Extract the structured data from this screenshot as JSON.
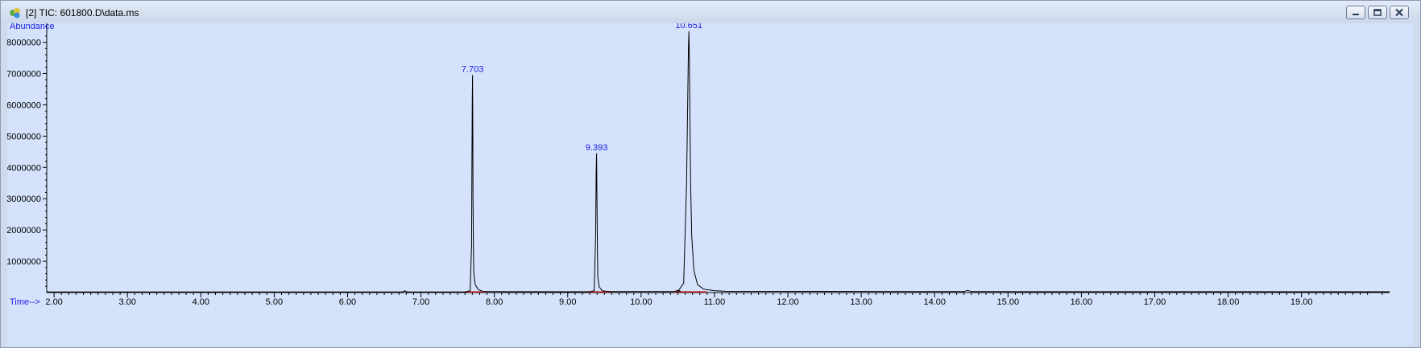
{
  "window": {
    "title": "[2] TIC: 601800.D\\data.ms"
  },
  "colors": {
    "plot_background": "#d4e3fb",
    "trace": "#000000",
    "peak_label": "#1a1ae6",
    "baseline_marker": "#e03030"
  },
  "chart_data": {
    "type": "line",
    "xlabel": "Time-->",
    "ylabel": "Abundance",
    "xlim": [
      1.9,
      20.2
    ],
    "ylim": [
      0,
      8400000
    ],
    "x_ticks": [
      "2.00",
      "3.00",
      "4.00",
      "5.00",
      "6.00",
      "7.00",
      "8.00",
      "9.00",
      "10.00",
      "11.00",
      "12.00",
      "13.00",
      "14.00",
      "15.00",
      "16.00",
      "17.00",
      "18.00",
      "19.00"
    ],
    "y_ticks": [
      "1000000",
      "2000000",
      "3000000",
      "4000000",
      "5000000",
      "6000000",
      "7000000",
      "8000000"
    ],
    "grid": false,
    "series": [
      {
        "x": [
          1.9,
          6.75,
          6.78,
          6.81,
          7.6,
          7.67,
          7.69,
          7.695,
          7.7,
          7.703,
          7.706,
          7.71,
          7.715,
          7.72,
          7.74,
          7.78,
          7.85,
          9.3,
          9.36,
          9.38,
          9.388,
          9.393,
          9.398,
          9.405,
          9.41,
          9.43,
          9.47,
          9.55,
          10.45,
          10.5,
          10.53,
          10.5,
          10.58,
          10.62,
          10.635,
          10.645,
          10.651,
          10.657,
          10.665,
          10.675,
          10.69,
          10.72,
          10.77,
          10.85,
          11.0,
          11.15,
          14.4,
          14.45,
          14.5,
          20.2
        ],
        "y": [
          20000,
          20000,
          60000,
          20000,
          20000,
          60000,
          1500000,
          4400000,
          6200000,
          6950000,
          5600000,
          3000000,
          1400000,
          600000,
          250000,
          100000,
          30000,
          25000,
          60000,
          1800000,
          3900000,
          4450000,
          3200000,
          1200000,
          500000,
          180000,
          60000,
          30000,
          30000,
          70000,
          50000,
          30000,
          300000,
          3500000,
          6100000,
          7800000,
          8350000,
          7600000,
          5800000,
          3500000,
          1800000,
          700000,
          250000,
          110000,
          60000,
          40000,
          30000,
          70000,
          30000,
          25000
        ]
      }
    ],
    "peaks": [
      {
        "time": 7.703,
        "label": "7.703",
        "abundance": 6950000
      },
      {
        "time": 9.393,
        "label": "9.393",
        "abundance": 4450000
      },
      {
        "time": 10.651,
        "label": "10.651",
        "abundance": 8350000
      }
    ],
    "integration_baselines": [
      [
        7.6,
        7.9
      ],
      [
        9.25,
        9.6
      ],
      [
        10.45,
        10.9
      ]
    ]
  }
}
